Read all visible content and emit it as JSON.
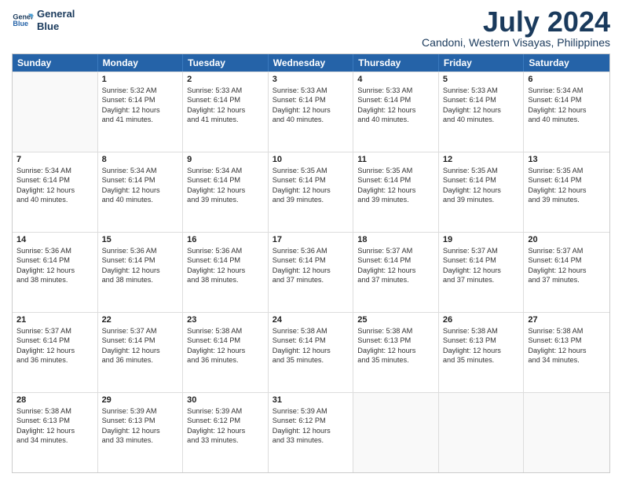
{
  "header": {
    "logo_line1": "General",
    "logo_line2": "Blue",
    "title": "July 2024",
    "subtitle": "Candoni, Western Visayas, Philippines"
  },
  "days": [
    "Sunday",
    "Monday",
    "Tuesday",
    "Wednesday",
    "Thursday",
    "Friday",
    "Saturday"
  ],
  "weeks": [
    [
      {
        "day": "",
        "lines": []
      },
      {
        "day": "1",
        "lines": [
          "Sunrise: 5:32 AM",
          "Sunset: 6:14 PM",
          "Daylight: 12 hours",
          "and 41 minutes."
        ]
      },
      {
        "day": "2",
        "lines": [
          "Sunrise: 5:33 AM",
          "Sunset: 6:14 PM",
          "Daylight: 12 hours",
          "and 41 minutes."
        ]
      },
      {
        "day": "3",
        "lines": [
          "Sunrise: 5:33 AM",
          "Sunset: 6:14 PM",
          "Daylight: 12 hours",
          "and 40 minutes."
        ]
      },
      {
        "day": "4",
        "lines": [
          "Sunrise: 5:33 AM",
          "Sunset: 6:14 PM",
          "Daylight: 12 hours",
          "and 40 minutes."
        ]
      },
      {
        "day": "5",
        "lines": [
          "Sunrise: 5:33 AM",
          "Sunset: 6:14 PM",
          "Daylight: 12 hours",
          "and 40 minutes."
        ]
      },
      {
        "day": "6",
        "lines": [
          "Sunrise: 5:34 AM",
          "Sunset: 6:14 PM",
          "Daylight: 12 hours",
          "and 40 minutes."
        ]
      }
    ],
    [
      {
        "day": "7",
        "lines": [
          "Sunrise: 5:34 AM",
          "Sunset: 6:14 PM",
          "Daylight: 12 hours",
          "and 40 minutes."
        ]
      },
      {
        "day": "8",
        "lines": [
          "Sunrise: 5:34 AM",
          "Sunset: 6:14 PM",
          "Daylight: 12 hours",
          "and 40 minutes."
        ]
      },
      {
        "day": "9",
        "lines": [
          "Sunrise: 5:34 AM",
          "Sunset: 6:14 PM",
          "Daylight: 12 hours",
          "and 39 minutes."
        ]
      },
      {
        "day": "10",
        "lines": [
          "Sunrise: 5:35 AM",
          "Sunset: 6:14 PM",
          "Daylight: 12 hours",
          "and 39 minutes."
        ]
      },
      {
        "day": "11",
        "lines": [
          "Sunrise: 5:35 AM",
          "Sunset: 6:14 PM",
          "Daylight: 12 hours",
          "and 39 minutes."
        ]
      },
      {
        "day": "12",
        "lines": [
          "Sunrise: 5:35 AM",
          "Sunset: 6:14 PM",
          "Daylight: 12 hours",
          "and 39 minutes."
        ]
      },
      {
        "day": "13",
        "lines": [
          "Sunrise: 5:35 AM",
          "Sunset: 6:14 PM",
          "Daylight: 12 hours",
          "and 39 minutes."
        ]
      }
    ],
    [
      {
        "day": "14",
        "lines": [
          "Sunrise: 5:36 AM",
          "Sunset: 6:14 PM",
          "Daylight: 12 hours",
          "and 38 minutes."
        ]
      },
      {
        "day": "15",
        "lines": [
          "Sunrise: 5:36 AM",
          "Sunset: 6:14 PM",
          "Daylight: 12 hours",
          "and 38 minutes."
        ]
      },
      {
        "day": "16",
        "lines": [
          "Sunrise: 5:36 AM",
          "Sunset: 6:14 PM",
          "Daylight: 12 hours",
          "and 38 minutes."
        ]
      },
      {
        "day": "17",
        "lines": [
          "Sunrise: 5:36 AM",
          "Sunset: 6:14 PM",
          "Daylight: 12 hours",
          "and 37 minutes."
        ]
      },
      {
        "day": "18",
        "lines": [
          "Sunrise: 5:37 AM",
          "Sunset: 6:14 PM",
          "Daylight: 12 hours",
          "and 37 minutes."
        ]
      },
      {
        "day": "19",
        "lines": [
          "Sunrise: 5:37 AM",
          "Sunset: 6:14 PM",
          "Daylight: 12 hours",
          "and 37 minutes."
        ]
      },
      {
        "day": "20",
        "lines": [
          "Sunrise: 5:37 AM",
          "Sunset: 6:14 PM",
          "Daylight: 12 hours",
          "and 37 minutes."
        ]
      }
    ],
    [
      {
        "day": "21",
        "lines": [
          "Sunrise: 5:37 AM",
          "Sunset: 6:14 PM",
          "Daylight: 12 hours",
          "and 36 minutes."
        ]
      },
      {
        "day": "22",
        "lines": [
          "Sunrise: 5:37 AM",
          "Sunset: 6:14 PM",
          "Daylight: 12 hours",
          "and 36 minutes."
        ]
      },
      {
        "day": "23",
        "lines": [
          "Sunrise: 5:38 AM",
          "Sunset: 6:14 PM",
          "Daylight: 12 hours",
          "and 36 minutes."
        ]
      },
      {
        "day": "24",
        "lines": [
          "Sunrise: 5:38 AM",
          "Sunset: 6:14 PM",
          "Daylight: 12 hours",
          "and 35 minutes."
        ]
      },
      {
        "day": "25",
        "lines": [
          "Sunrise: 5:38 AM",
          "Sunset: 6:13 PM",
          "Daylight: 12 hours",
          "and 35 minutes."
        ]
      },
      {
        "day": "26",
        "lines": [
          "Sunrise: 5:38 AM",
          "Sunset: 6:13 PM",
          "Daylight: 12 hours",
          "and 35 minutes."
        ]
      },
      {
        "day": "27",
        "lines": [
          "Sunrise: 5:38 AM",
          "Sunset: 6:13 PM",
          "Daylight: 12 hours",
          "and 34 minutes."
        ]
      }
    ],
    [
      {
        "day": "28",
        "lines": [
          "Sunrise: 5:38 AM",
          "Sunset: 6:13 PM",
          "Daylight: 12 hours",
          "and 34 minutes."
        ]
      },
      {
        "day": "29",
        "lines": [
          "Sunrise: 5:39 AM",
          "Sunset: 6:13 PM",
          "Daylight: 12 hours",
          "and 33 minutes."
        ]
      },
      {
        "day": "30",
        "lines": [
          "Sunrise: 5:39 AM",
          "Sunset: 6:12 PM",
          "Daylight: 12 hours",
          "and 33 minutes."
        ]
      },
      {
        "day": "31",
        "lines": [
          "Sunrise: 5:39 AM",
          "Sunset: 6:12 PM",
          "Daylight: 12 hours",
          "and 33 minutes."
        ]
      },
      {
        "day": "",
        "lines": []
      },
      {
        "day": "",
        "lines": []
      },
      {
        "day": "",
        "lines": []
      }
    ]
  ]
}
